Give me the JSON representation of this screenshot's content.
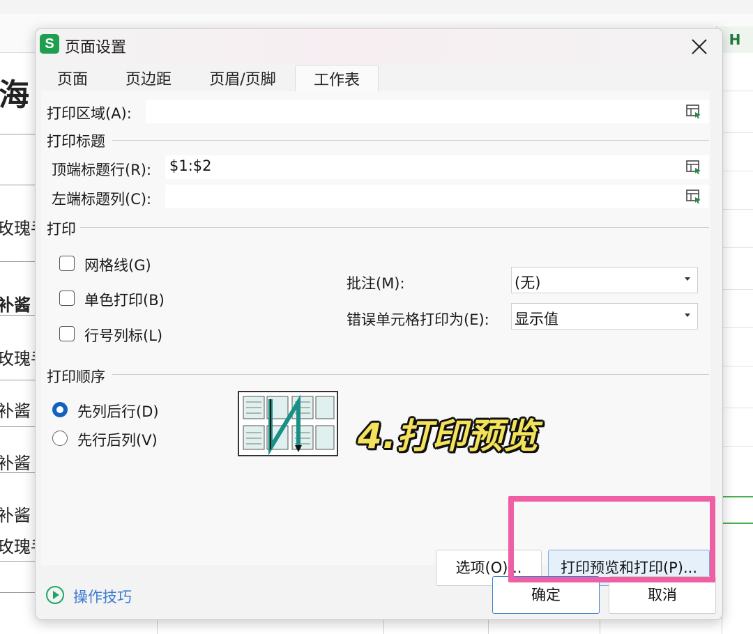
{
  "background": {
    "column_header_h": "H",
    "left_fragments": [
      "海",
      "玫瑰手",
      "补酱",
      "玫瑰手",
      "补酱",
      "补酱",
      "补酱",
      "玫瑰手"
    ]
  },
  "dialog": {
    "title": "页面设置",
    "app_icon_letter": "S",
    "tabs": [
      {
        "label": "页面"
      },
      {
        "label": "页边距"
      },
      {
        "label": "页眉/页脚"
      },
      {
        "label": "工作表"
      }
    ],
    "print_area_label": "打印区域(A):",
    "print_area_value": "",
    "print_titles_heading": "打印标题",
    "top_rows_label": "顶端标题行(R):",
    "top_rows_value": "$1:$2",
    "left_cols_label": "左端标题列(C):",
    "left_cols_value": "",
    "print_heading": "打印",
    "checkboxes": [
      {
        "label": "网格线(G)",
        "checked": false
      },
      {
        "label": "单色打印(B)",
        "checked": false
      },
      {
        "label": "行号列标(L)",
        "checked": false
      }
    ],
    "comments_label": "批注(M):",
    "comments_value": "(无)",
    "cell_errors_label": "错误单元格打印为(E):",
    "cell_errors_value": "显示值",
    "page_order_heading": "打印顺序",
    "radios": [
      {
        "label": "先列后行(D)",
        "selected": true
      },
      {
        "label": "先行后列(V)",
        "selected": false
      }
    ],
    "options_button": "选项(O)...",
    "print_preview_button": "打印预览和打印(P)...",
    "tips_link": "操作技巧",
    "ok_button": "确定",
    "cancel_button": "取消"
  },
  "overlay_caption": "4.打印预览",
  "colors": {
    "accent_blue": "#1560c0",
    "highlight_pink": "#ef5fa4",
    "caption_yellow": "#f4e35a",
    "app_green": "#1f9e4f"
  }
}
